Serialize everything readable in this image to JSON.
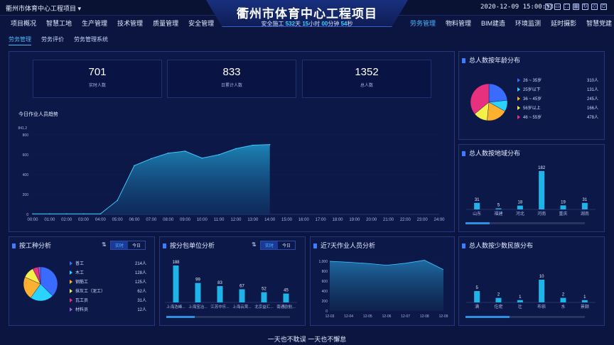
{
  "header": {
    "project_selector": "衢州市体育中心工程项目 ▾",
    "title": "衢州市体育中心工程项目",
    "safety": {
      "prefix": "安全施工",
      "days": "532",
      "days_unit": "天",
      "hours": "15",
      "hours_unit": "小时",
      "minutes": "00",
      "minutes_unit": "分钟",
      "seconds": "54",
      "seconds_unit": "秒"
    },
    "datetime": "2020-12-09 15:00:53"
  },
  "nav_left": [
    "项目概况",
    "智慧工地",
    "生产管理",
    "技术管理",
    "质量管理",
    "安全管理"
  ],
  "nav_right": [
    "劳务管理",
    "物料管理",
    "BIM建造",
    "环境监测",
    "延时摄影",
    "智慧党建"
  ],
  "nav_active": "劳务管理",
  "subnav": [
    "劳务管理",
    "劳务评价",
    "劳务管理系统"
  ],
  "kpis": [
    {
      "value": "701",
      "label": "实时人数"
    },
    {
      "value": "833",
      "label": "日累计人数"
    },
    {
      "value": "1352",
      "label": "总人数"
    }
  ],
  "trend": {
    "title": "今日作业人员趋势",
    "ymax_label": "841.2",
    "yticks": [
      "800",
      "600",
      "400",
      "200",
      "0"
    ],
    "xticks": [
      "00:00",
      "01:00",
      "02:00",
      "03:00",
      "04:00",
      "05:00",
      "06:00",
      "07:00",
      "08:00",
      "09:00",
      "10:00",
      "11:00",
      "12:00",
      "13:00",
      "14:00",
      "15:00",
      "16:00",
      "17:00",
      "18:00",
      "19:00",
      "20:00",
      "21:00",
      "22:00",
      "23:00",
      "24:00"
    ]
  },
  "age_panel": {
    "title": "总人数按年龄分布",
    "items": [
      {
        "name": "26 ~ 35岁",
        "value": "310人",
        "color": "#3a6bff"
      },
      {
        "name": "25岁以下",
        "value": "131人",
        "color": "#2ad4ff"
      },
      {
        "name": "36 ~ 45岁",
        "value": "245人",
        "color": "#ffb02e"
      },
      {
        "name": "56岁以上",
        "value": "166人",
        "color": "#f4f04a"
      },
      {
        "name": "46 ~ 55岁",
        "value": "478人",
        "color": "#e8317e"
      }
    ]
  },
  "region_panel": {
    "title": "总人数按地域分布"
  },
  "work_panel": {
    "title": "按工种分析",
    "toggle": [
      "实时",
      "今日"
    ],
    "items": [
      {
        "name": "普工",
        "value": "214人",
        "color": "#3a6bff"
      },
      {
        "name": "木工",
        "value": "128人",
        "color": "#2ad4ff"
      },
      {
        "name": "钢筋工",
        "value": "125人",
        "color": "#ffb02e"
      },
      {
        "name": "抹灰工（泥工）",
        "value": "62人",
        "color": "#f4f04a"
      },
      {
        "name": "瓦工员",
        "value": "31人",
        "color": "#e8317e"
      },
      {
        "name": "材料员",
        "value": "12人",
        "color": "#9b59d6"
      }
    ]
  },
  "sub_panel": {
    "title": "按分包单位分析",
    "toggle": [
      "实时",
      "今日"
    ]
  },
  "week_panel": {
    "title": "近7天作业人员分析",
    "yticks": [
      "1,000",
      "800",
      "600",
      "400",
      "200",
      "0"
    ]
  },
  "minority_panel": {
    "title": "总人数按少数民族分布"
  },
  "footer": "一天也不耽误 一天也不懈怠",
  "chart_data": [
    {
      "type": "area",
      "title": "今日作业人员趋势",
      "x": [
        "00:00",
        "01:00",
        "02:00",
        "03:00",
        "04:00",
        "05:00",
        "06:00",
        "07:00",
        "08:00",
        "09:00",
        "10:00",
        "11:00",
        "12:00",
        "13:00",
        "14:00"
      ],
      "values": [
        5,
        5,
        5,
        5,
        5,
        140,
        490,
        560,
        615,
        635,
        565,
        600,
        660,
        695,
        701
      ],
      "ylim": [
        0,
        841.2
      ]
    },
    {
      "type": "pie",
      "title": "总人数按年龄分布",
      "categories": [
        "26 ~ 35岁",
        "25岁以下",
        "36 ~ 45岁",
        "56岁以上",
        "46 ~ 55岁"
      ],
      "values": [
        310,
        131,
        245,
        166,
        478
      ]
    },
    {
      "type": "bar",
      "title": "总人数按地域分布",
      "categories": [
        "山东",
        "福建",
        "河北",
        "河南",
        "重庆",
        "湖南"
      ],
      "values": [
        31,
        5,
        18,
        182,
        19,
        31
      ]
    },
    {
      "type": "pie",
      "title": "按工种分析",
      "categories": [
        "普工",
        "木工",
        "钢筋工",
        "抹灰工（泥工）",
        "瓦工员",
        "材料员"
      ],
      "values": [
        214,
        128,
        125,
        62,
        31,
        12
      ]
    },
    {
      "type": "bar",
      "title": "按分包单位分析",
      "categories": [
        "上海浩峰...",
        "上海宝冶...",
        "江苏中乐...",
        "上海云霄...",
        "北京益汇...",
        "南通欧航..."
      ],
      "values": [
        188,
        99,
        83,
        67,
        52,
        45
      ]
    },
    {
      "type": "area",
      "title": "近7天作业人员分析",
      "x": [
        "12-03",
        "12-04",
        "12-05",
        "12-06",
        "12-07",
        "12-08",
        "12-09"
      ],
      "values": [
        1000,
        980,
        955,
        920,
        960,
        1020,
        830
      ],
      "ylim": [
        0,
        1000
      ]
    },
    {
      "type": "bar",
      "title": "总人数按少数民族分布",
      "categories": [
        "满",
        "仡佬",
        "壮",
        "布依",
        "水",
        "景颇"
      ],
      "values": [
        5,
        2,
        1,
        10,
        2,
        1
      ]
    }
  ]
}
